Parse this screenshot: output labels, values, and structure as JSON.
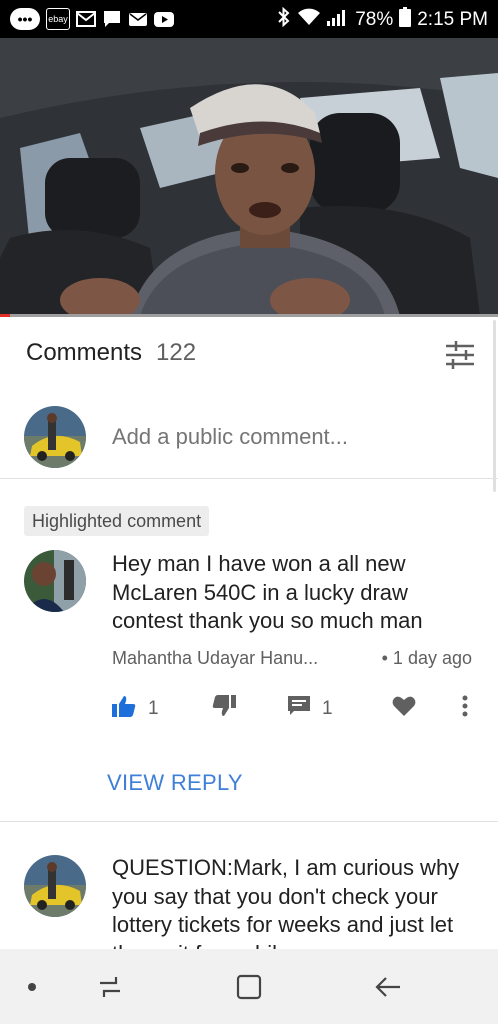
{
  "status_bar": {
    "battery": "78%",
    "time": "2:15 PM",
    "notification_icons": [
      "more-notifications-icon",
      "ebay-icon",
      "gmail-icon",
      "chat-icon",
      "email-icon",
      "youtube-icon"
    ],
    "system_icons": [
      "bluetooth-icon",
      "wifi-icon",
      "signal-icon",
      "battery-icon"
    ],
    "ebay_label": "ebay"
  },
  "video": {
    "progress_fraction": 0.02
  },
  "comments_header": {
    "title": "Comments",
    "count": "122"
  },
  "add_comment": {
    "placeholder": "Add a public comment..."
  },
  "comments": [
    {
      "badge": "Highlighted comment",
      "text": "Hey man I have won a all new McLaren 540C in a lucky draw contest thank you so much man",
      "author": "Mahantha Udayar Hanu...",
      "time": "• 1 day ago",
      "likes": "1",
      "replies": "1",
      "view_reply": "VIEW REPLY"
    },
    {
      "text": "QUESTION:Mark, I am curious why you say that you don't check your lottery tickets for weeks and just let them sit for awhile"
    }
  ],
  "colors": {
    "accent_blue": "#3e7fd8",
    "progress_red": "#e52d27",
    "nav_bg": "#f1f1f1"
  }
}
